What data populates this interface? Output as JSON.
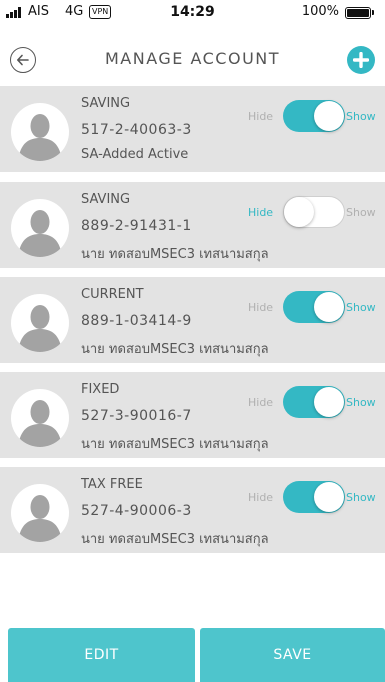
{
  "status_bar": {
    "carrier": "AIS",
    "network": "4G",
    "vpn": "VPN",
    "time": "14:29",
    "battery": "100%"
  },
  "header": {
    "title": "MANAGE ACCOUNT",
    "back_icon": "circle-arrow-left-icon",
    "add_icon": "plus-circle-icon"
  },
  "accounts": [
    {
      "type": "SAVING",
      "number": "517-2-40063-3",
      "name": "SA-Added Active",
      "hide_label": "Hide",
      "show_label": "Show",
      "visible": true
    },
    {
      "type": "SAVING",
      "number": "889-2-91431-1",
      "name": "นาย ทดสอบMSEC3 เทสนามสกุล",
      "hide_label": "Hide",
      "show_label": "Show",
      "visible": false
    },
    {
      "type": "CURRENT",
      "number": "889-1-03414-9",
      "name": "นาย ทดสอบMSEC3 เทสนามสกุล",
      "hide_label": "Hide",
      "show_label": "Show",
      "visible": true
    },
    {
      "type": "FIXED",
      "number": "527-3-90016-7",
      "name": "นาย ทดสอบMSEC3 เทสนามสกุล",
      "hide_label": "Hide",
      "show_label": "Show",
      "visible": true
    },
    {
      "type": "TAX FREE",
      "number": "527-4-90006-3",
      "name": "นาย ทดสอบMSEC3 เทสนามสกุล",
      "hide_label": "Hide",
      "show_label": "Show",
      "visible": true
    }
  ],
  "buttons": {
    "edit": "EDIT",
    "save": "SAVE"
  },
  "colors": {
    "accent": "#34b8c4",
    "button": "#4ec5cc",
    "row_bg": "#e3e3e3"
  }
}
